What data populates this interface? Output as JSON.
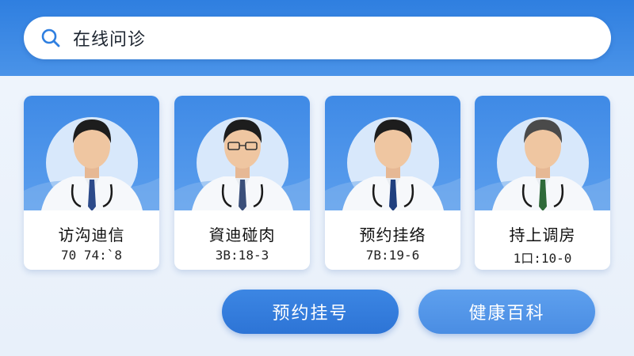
{
  "search": {
    "icon": "search-icon",
    "text": "在线问诊"
  },
  "doctors": [
    {
      "name": "访沟迪信",
      "info": "70 74:`8",
      "tie_color": "#2c4a8a"
    },
    {
      "name": "資迪碰肉",
      "info": "3B:18-3",
      "tie_color": "#3a4f7a"
    },
    {
      "name": "预约挂络",
      "info": "7B:19-6",
      "tie_color": "#1f3f7f"
    },
    {
      "name": "持上调房",
      "info": "1口:10-0",
      "tie_color": "#2f6a3a"
    }
  ],
  "actions": {
    "book_label": "预约挂号",
    "wiki_label": "健康百科"
  },
  "colors": {
    "accent": "#2f7fe0",
    "card_bg": "#ffffff",
    "page_bg": "#edf3fb"
  }
}
